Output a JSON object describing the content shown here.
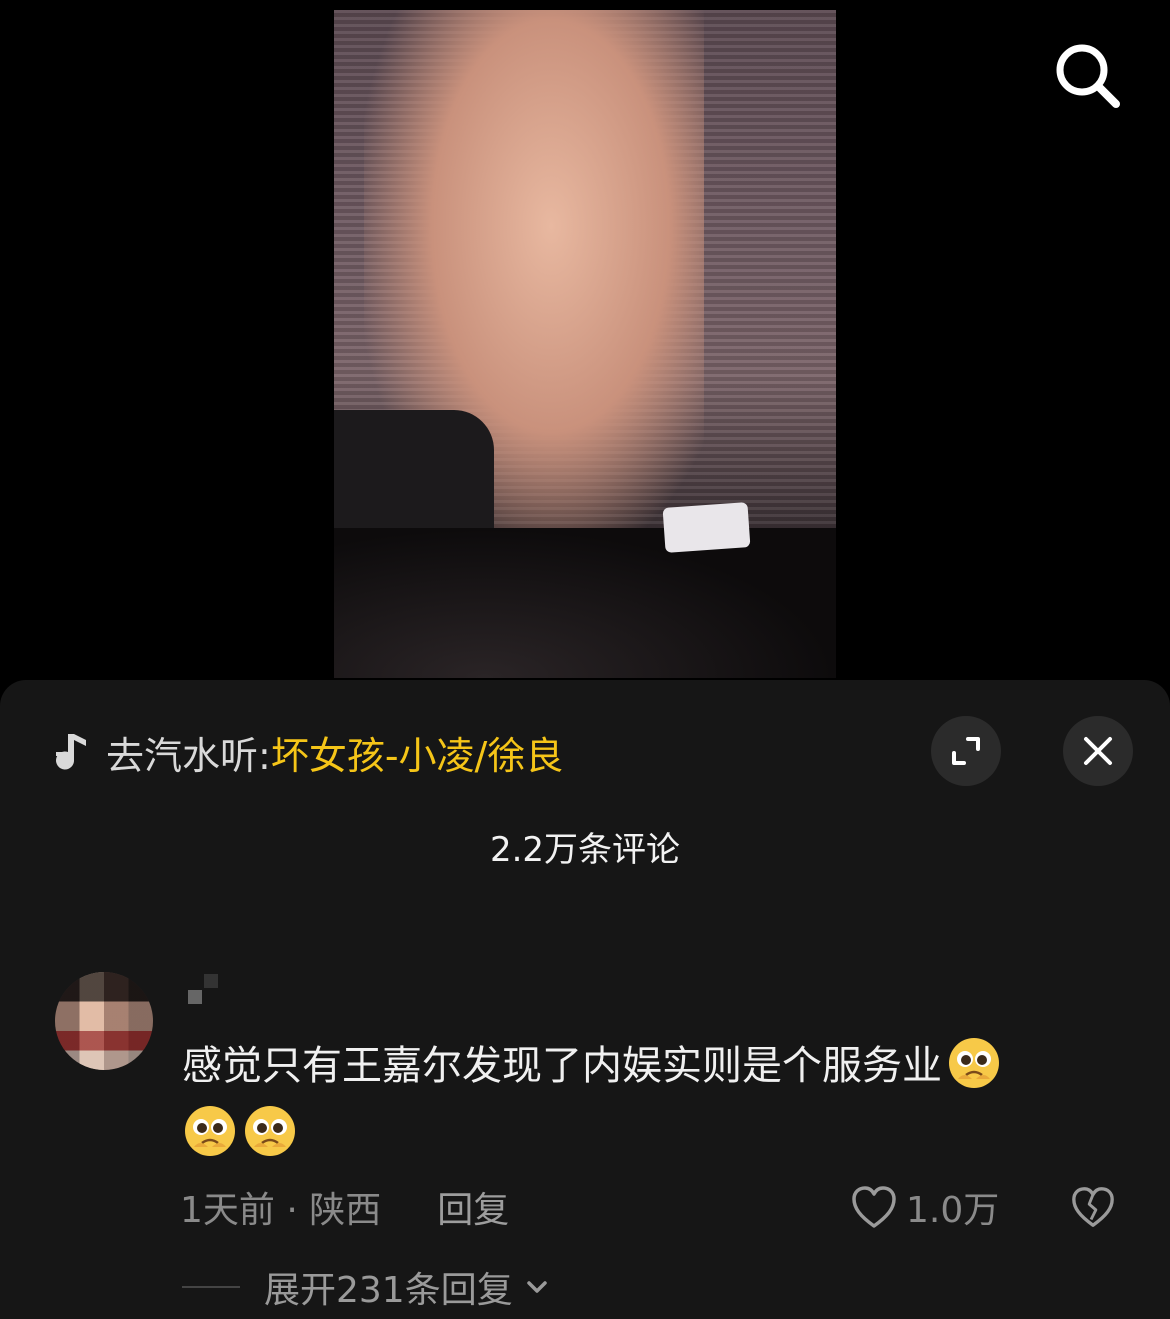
{
  "music": {
    "prefix": "去汽水听:",
    "song": "坏女孩-小凌/徐良"
  },
  "comments_header": {
    "count_label": "2.2万条评论"
  },
  "comment": {
    "text": "感觉只有王嘉尔发现了内娱实则是个服务业",
    "time_location": "1天前 · 陕西",
    "reply_label": "回复",
    "like_count": "1.0万",
    "expand_label": "展开231条回复"
  },
  "icons": {
    "search": "search-icon",
    "music_note": "music-note-icon",
    "expand": "expand-icon",
    "close": "close-icon",
    "heart": "heart-icon",
    "broken_heart": "broken-heart-icon",
    "chevron": "chevron-down-icon",
    "emoji": "pleading-face-emoji"
  },
  "colors": {
    "accent_song": "#f5c518",
    "sheet_bg": "#161616",
    "page_bg": "#000000"
  }
}
